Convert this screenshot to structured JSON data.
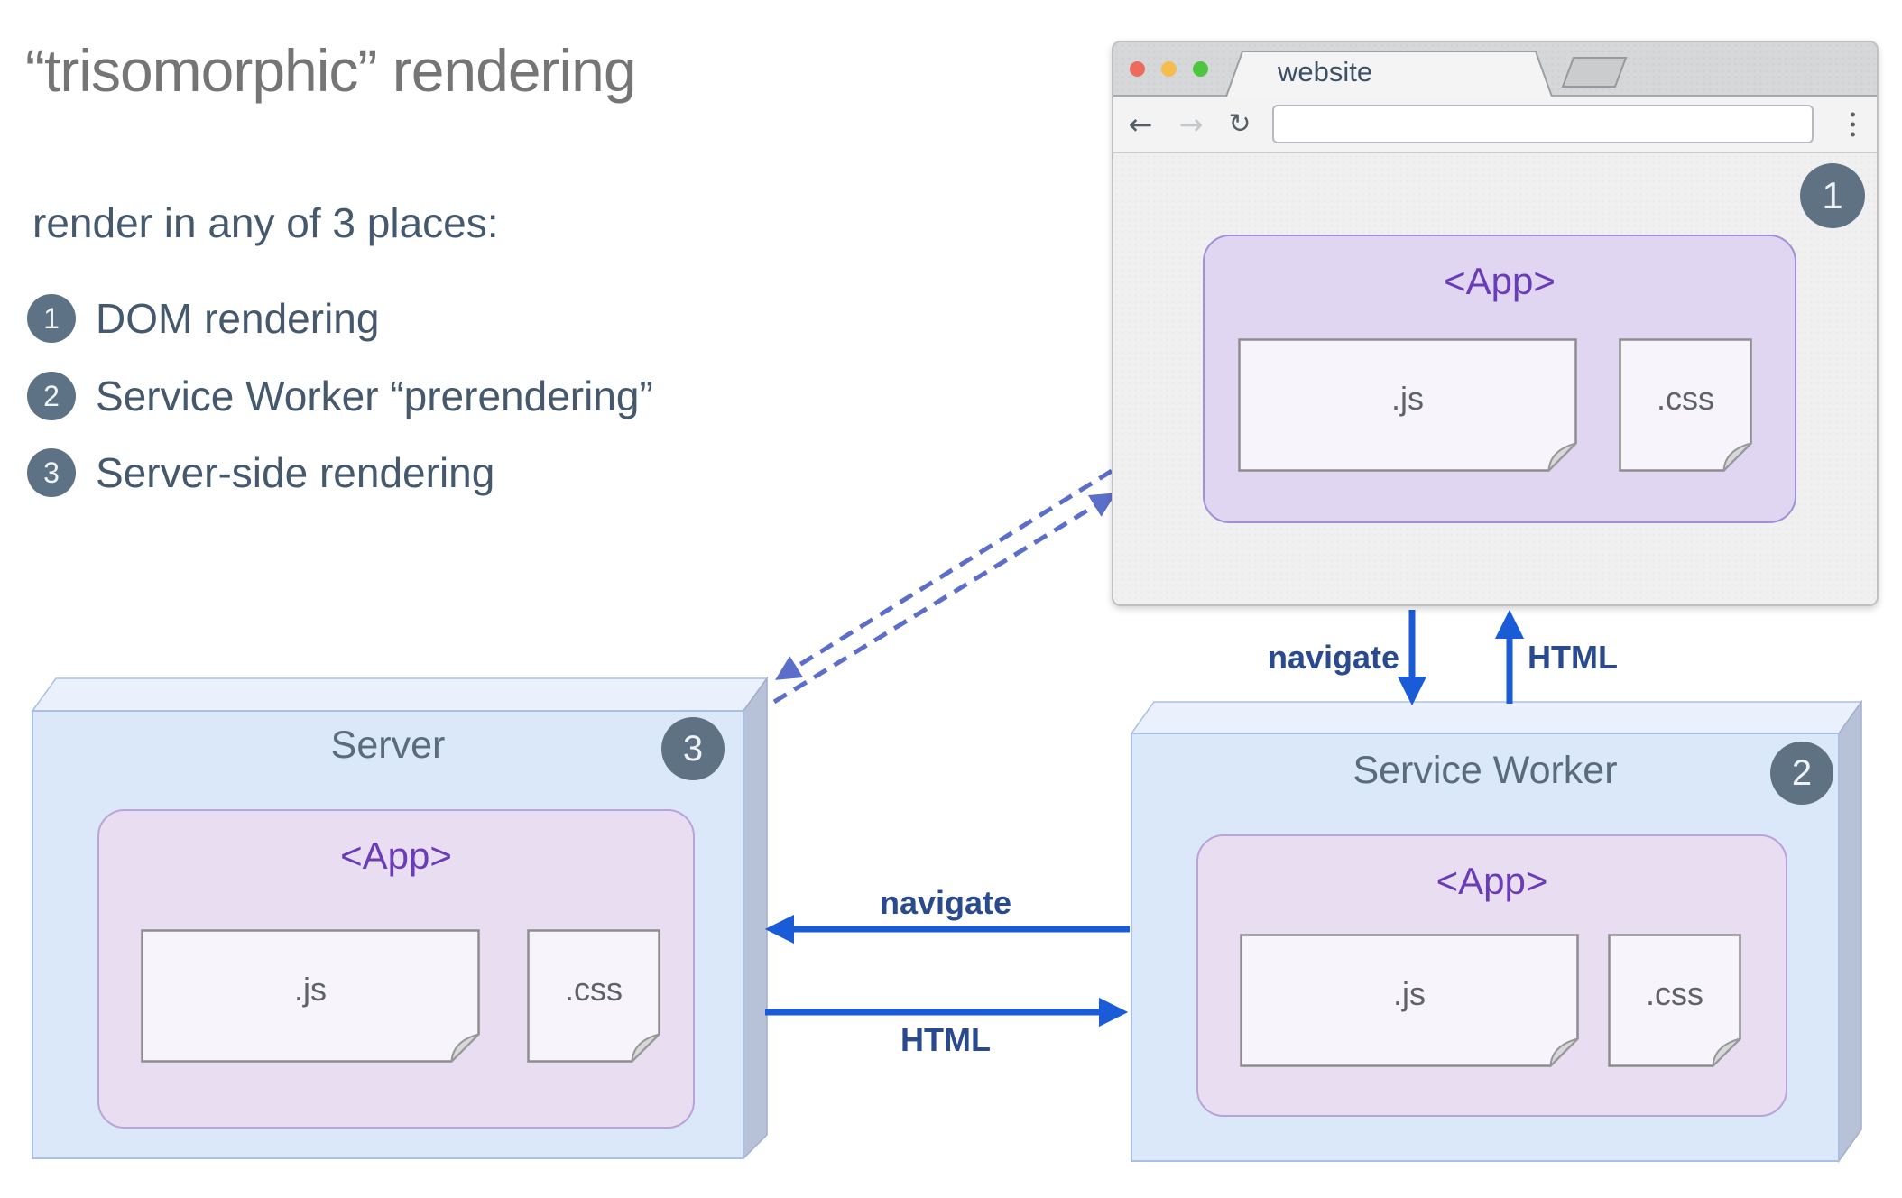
{
  "headline": {
    "title": "“trisomorphic” rendering",
    "subtitle": "render in any of 3 places:",
    "items": [
      {
        "number": "1",
        "label": "DOM rendering"
      },
      {
        "number": "2",
        "label": "Service Worker “prerendering”"
      },
      {
        "number": "3",
        "label": "Server-side rendering"
      }
    ]
  },
  "browser": {
    "tab_title": "website",
    "url_value": "",
    "badge": "1",
    "app_label": "<App>",
    "files": [
      {
        "label": ".js"
      },
      {
        "label": ".css"
      }
    ]
  },
  "service_worker": {
    "title": "Service Worker",
    "badge": "2",
    "app_label": "<App>",
    "files": [
      {
        "label": ".js"
      },
      {
        "label": ".css"
      }
    ]
  },
  "server": {
    "title": "Server",
    "badge": "3",
    "app_label": "<App>",
    "files": [
      {
        "label": ".js"
      },
      {
        "label": ".css"
      }
    ]
  },
  "arrows": {
    "navigate_down": {
      "label": "navigate"
    },
    "html_up": {
      "label": "HTML"
    },
    "navigate_left": {
      "label": "navigate"
    },
    "html_right": {
      "label": "HTML"
    }
  },
  "colors": {
    "accent_blue": "#1a5bd7",
    "dashed_periwinkle": "#5b6fca",
    "arrow_label_navy": "#2a4a90",
    "badge_slate": "#5f7283",
    "app_purple": "#6a3cb8",
    "box_face_blue": "#dbe8f9",
    "card_lavender": "#e9def1",
    "file_background": "#f7f5fb",
    "title_gray": "#757575",
    "text_slate": "#45596e"
  }
}
